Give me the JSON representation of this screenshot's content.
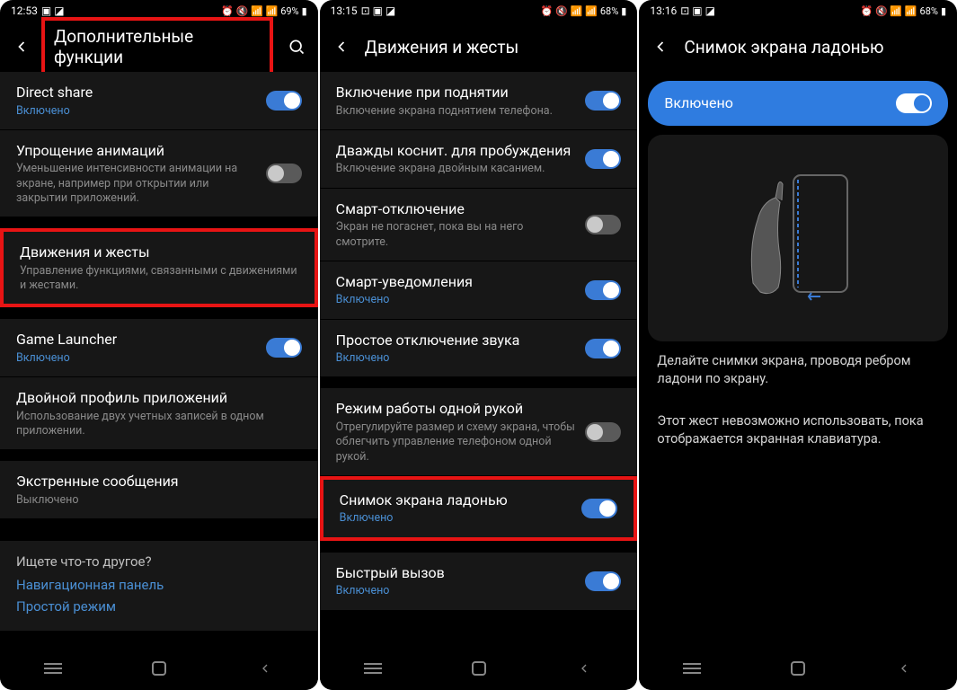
{
  "screen1": {
    "status": {
      "time": "12:53",
      "battery": "69%"
    },
    "title": "Дополнительные функции",
    "rows": [
      {
        "title": "Direct share",
        "sub": "Включено",
        "subClass": "on",
        "toggle": "on"
      },
      {
        "title": "Упрощение анимаций",
        "sub": "Уменьшение интенсивности анимации на экране, например при открытии или закрытии приложений.",
        "subClass": "",
        "toggle": "off"
      },
      {
        "title": "Движения и жесты",
        "sub": "Управление функциями, связанными с движениями и жестами.",
        "subClass": "",
        "toggle": null,
        "highlight": true
      },
      {
        "title": "Game Launcher",
        "sub": "Включено",
        "subClass": "on",
        "toggle": "on"
      },
      {
        "title": "Двойной профиль приложений",
        "sub": "Использование двух учетных записей в одном приложении.",
        "subClass": "",
        "toggle": null
      },
      {
        "title": "Экстренные сообщения",
        "sub": "Выключено",
        "subClass": "off",
        "toggle": null
      }
    ],
    "suggest": {
      "title": "Ищете что-то другое?",
      "links": [
        "Навигационная панель",
        "Простой режим"
      ]
    }
  },
  "screen2": {
    "status": {
      "time": "13:15",
      "battery": "68%"
    },
    "title": "Движения и жесты",
    "rows": [
      {
        "title": "Включение при поднятии",
        "sub": "Включение экрана поднятием телефона.",
        "subClass": "",
        "toggle": "on"
      },
      {
        "title": "Дважды коснит. для пробуждения",
        "sub": "Включение экрана двойным касанием.",
        "subClass": "",
        "toggle": "on"
      },
      {
        "title": "Смарт-отключение",
        "sub": "Экран не погаснет, пока вы на него смотрите.",
        "subClass": "",
        "toggle": "off"
      },
      {
        "title": "Смарт-уведомления",
        "sub": "Включено",
        "subClass": "on",
        "toggle": "on"
      },
      {
        "title": "Простое отключение звука",
        "sub": "Включено",
        "subClass": "on",
        "toggle": "on"
      },
      {
        "title": "Режим работы одной рукой",
        "sub": "Отрегулируйте размер и схему экрана, чтобы облегчить управление телефоном одной рукой.",
        "subClass": "",
        "toggle": "off"
      },
      {
        "title": "Снимок экрана ладонью",
        "sub": "Включено",
        "subClass": "on",
        "toggle": "on",
        "highlight": true
      },
      {
        "title": "Быстрый вызов",
        "sub": "Включено",
        "subClass": "on",
        "toggle": "on"
      }
    ]
  },
  "screen3": {
    "status": {
      "time": "13:16",
      "battery": "68%"
    },
    "title": "Снимок экрана ладонью",
    "enabled_label": "Включено",
    "desc1": "Делайте снимки экрана, проводя ребром ладони по экрану.",
    "desc2": "Этот жест невозможно использовать, пока отображается экранная клавиатура."
  }
}
